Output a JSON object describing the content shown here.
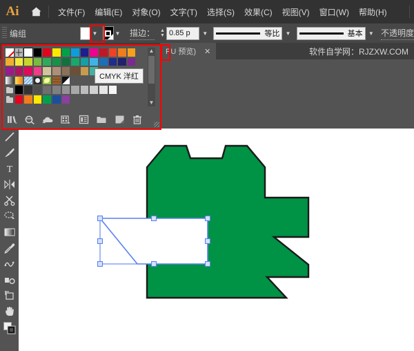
{
  "app": {
    "logo_text": "Ai",
    "home_icon": "home-icon"
  },
  "menubar": {
    "items": [
      {
        "label": "文件(F)",
        "name": "menu-file"
      },
      {
        "label": "编辑(E)",
        "name": "menu-edit"
      },
      {
        "label": "对象(O)",
        "name": "menu-object"
      },
      {
        "label": "文字(T)",
        "name": "menu-type"
      },
      {
        "label": "选择(S)",
        "name": "menu-select"
      },
      {
        "label": "效果(C)",
        "name": "menu-effect"
      },
      {
        "label": "视图(V)",
        "name": "menu-view"
      },
      {
        "label": "窗口(W)",
        "name": "menu-window"
      },
      {
        "label": "帮助(H)",
        "name": "menu-help"
      }
    ]
  },
  "controlbar": {
    "selection_label": "编组",
    "fill_color": "#ffffff",
    "stroke_color": "#000000",
    "stroke_label": "描边：",
    "stroke_weight": "0.85 p",
    "variable_width_profile": "等比",
    "brush_definition": "基本",
    "opacity_label": "不透明度"
  },
  "tabstrip": {
    "document_tab": "PU 预览)",
    "close_label": "✕",
    "watermark": "软件自学网：RJZXW.COM"
  },
  "swatches": {
    "panel_name": "swatches-panel",
    "tooltip": "CMYK 洋红",
    "rows": [
      [
        {
          "type": "none",
          "name": "swatch-none"
        },
        {
          "type": "registration",
          "name": "swatch-registration"
        },
        {
          "type": "white",
          "name": "swatch-white"
        },
        {
          "type": "solid",
          "color": "#000000",
          "name": "swatch-black"
        },
        {
          "type": "solid",
          "color": "#e3051c",
          "name": "swatch-red"
        },
        {
          "type": "solid",
          "color": "#ffe800",
          "name": "swatch-yellow"
        },
        {
          "type": "solid",
          "color": "#00a14b",
          "name": "swatch-green"
        },
        {
          "type": "solid",
          "color": "#0d9ddb",
          "name": "swatch-cyan"
        },
        {
          "type": "solid",
          "color": "#1b1f8f",
          "name": "swatch-blue"
        },
        {
          "type": "solid",
          "color": "#ec038f",
          "name": "swatch-magenta"
        },
        {
          "type": "solid",
          "color": "#c01728",
          "name": "swatch-dark-red"
        },
        {
          "type": "solid",
          "color": "#ef4123",
          "name": "swatch-red-orange"
        },
        {
          "type": "solid",
          "color": "#f07d1c",
          "name": "swatch-orange"
        },
        {
          "type": "solid",
          "color": "#f6a11d",
          "name": "swatch-amber"
        }
      ],
      [
        {
          "type": "solid",
          "color": "#f2ae30",
          "name": "swatch-gold"
        },
        {
          "type": "solid",
          "color": "#f2ea3a",
          "name": "swatch-light-yellow"
        },
        {
          "type": "solid",
          "color": "#c8d62c",
          "name": "swatch-lime-yellow"
        },
        {
          "type": "solid",
          "color": "#76bb42",
          "name": "swatch-light-green"
        },
        {
          "type": "solid",
          "color": "#2eab5a",
          "name": "swatch-medium-green"
        },
        {
          "type": "solid",
          "color": "#189049",
          "name": "swatch-forest-green"
        },
        {
          "type": "solid",
          "color": "#11713f",
          "name": "swatch-dark-green"
        },
        {
          "type": "solid",
          "color": "#18a86b",
          "name": "swatch-emerald"
        },
        {
          "type": "solid",
          "color": "#13a0a6",
          "name": "swatch-teal"
        },
        {
          "type": "solid",
          "color": "#3fb3e8",
          "name": "swatch-sky-blue"
        },
        {
          "type": "solid",
          "color": "#1a6fb8",
          "name": "swatch-steel-blue"
        },
        {
          "type": "solid",
          "color": "#1d2e8c",
          "name": "swatch-navy"
        },
        {
          "type": "solid",
          "color": "#21216b",
          "name": "swatch-dark-navy"
        },
        {
          "type": "solid",
          "color": "#7b2a8e",
          "name": "swatch-purple"
        }
      ],
      [
        {
          "type": "solid",
          "color": "#9c1a8c",
          "name": "swatch-violet"
        },
        {
          "type": "solid",
          "color": "#b01262",
          "name": "swatch-fuchsia"
        },
        {
          "type": "solid",
          "color": "#e3075c",
          "name": "swatch-crimson"
        },
        {
          "type": "solid",
          "color": "#ef3e87",
          "name": "swatch-pink"
        },
        {
          "type": "solid",
          "color": "#cfc49a",
          "name": "swatch-beige"
        },
        {
          "type": "solid",
          "color": "#ad8f76",
          "name": "swatch-tan"
        },
        {
          "type": "solid",
          "color": "#8b7257",
          "name": "swatch-taupe"
        },
        {
          "type": "solid",
          "color": "#6d4f33",
          "name": "swatch-brown"
        },
        {
          "type": "solid",
          "color": "#c89a4e",
          "name": "swatch-sand"
        },
        {
          "type": "solid",
          "color": "#3fb3a0",
          "name": "swatch-aqua"
        },
        {
          "type": "empty",
          "name": "swatch-empty"
        },
        {
          "type": "empty",
          "name": "swatch-empty"
        },
        {
          "type": "empty",
          "name": "swatch-empty"
        },
        {
          "type": "empty",
          "name": "swatch-empty"
        }
      ],
      [
        {
          "type": "grad-bw",
          "name": "swatch-gradient-white-black"
        },
        {
          "type": "grad-ylo",
          "name": "swatch-gradient-yellow-orange"
        },
        {
          "type": "grad-blue",
          "name": "swatch-pattern-blue-check"
        },
        {
          "type": "pat-dot",
          "name": "swatch-pattern-dot"
        },
        {
          "type": "pat-leaf",
          "name": "swatch-pattern-leaf"
        },
        {
          "type": "pat-brick",
          "name": "swatch-pattern-brick"
        },
        {
          "type": "half",
          "name": "swatch-pattern-diagonal"
        },
        {
          "type": "empty",
          "name": "swatch-empty"
        },
        {
          "type": "empty",
          "name": "swatch-empty"
        },
        {
          "type": "empty",
          "name": "swatch-empty"
        },
        {
          "type": "empty",
          "name": "swatch-empty"
        },
        {
          "type": "empty",
          "name": "swatch-empty"
        },
        {
          "type": "empty",
          "name": "swatch-empty"
        },
        {
          "type": "empty",
          "name": "swatch-empty"
        }
      ],
      [
        {
          "type": "folder",
          "name": "swatch-group-grayscale"
        },
        {
          "type": "solid",
          "color": "#000000",
          "name": "swatch-gray-0"
        },
        {
          "type": "solid",
          "color": "#333333",
          "name": "swatch-gray-10"
        },
        {
          "type": "solid",
          "color": "#4f4f4f",
          "name": "swatch-gray-20"
        },
        {
          "type": "solid",
          "color": "#6e6e6e",
          "name": "swatch-gray-30"
        },
        {
          "type": "solid",
          "color": "#808080",
          "name": "swatch-gray-40"
        },
        {
          "type": "solid",
          "color": "#949494",
          "name": "swatch-gray-50"
        },
        {
          "type": "solid",
          "color": "#a8a8a8",
          "name": "swatch-gray-60"
        },
        {
          "type": "solid",
          "color": "#bdbdbd",
          "name": "swatch-gray-70"
        },
        {
          "type": "solid",
          "color": "#d2d2d2",
          "name": "swatch-gray-80"
        },
        {
          "type": "solid",
          "color": "#e6e6e6",
          "name": "swatch-gray-90"
        },
        {
          "type": "solid",
          "color": "#f5f5f5",
          "name": "swatch-gray-95"
        },
        {
          "type": "empty",
          "name": "swatch-empty"
        },
        {
          "type": "empty",
          "name": "swatch-empty"
        }
      ],
      [
        {
          "type": "folder",
          "name": "swatch-group-brights"
        },
        {
          "type": "solid",
          "color": "#e3051c",
          "name": "swatch-bright-red"
        },
        {
          "type": "solid",
          "color": "#f07d1c",
          "name": "swatch-bright-orange"
        },
        {
          "type": "solid",
          "color": "#ffe800",
          "name": "swatch-bright-yellow"
        },
        {
          "type": "solid",
          "color": "#00a14b",
          "name": "swatch-bright-green"
        },
        {
          "type": "solid",
          "color": "#1a4fa0",
          "name": "swatch-bright-blue"
        },
        {
          "type": "solid",
          "color": "#8b3f9e",
          "name": "swatch-bright-purple"
        },
        {
          "type": "empty",
          "name": "swatch-empty"
        },
        {
          "type": "empty",
          "name": "swatch-empty"
        },
        {
          "type": "empty",
          "name": "swatch-empty"
        },
        {
          "type": "empty",
          "name": "swatch-empty"
        },
        {
          "type": "empty",
          "name": "swatch-empty"
        },
        {
          "type": "empty",
          "name": "swatch-empty"
        },
        {
          "type": "empty",
          "name": "swatch-empty"
        }
      ]
    ],
    "footer_icons": [
      {
        "name": "swatch-libraries-icon"
      },
      {
        "name": "show-swatch-kinds-icon"
      },
      {
        "name": "color-themes-cloud-icon"
      },
      {
        "name": "color-group-icon"
      },
      {
        "name": "swatch-options-icon"
      },
      {
        "name": "new-color-group-icon"
      },
      {
        "name": "new-swatch-icon"
      },
      {
        "name": "delete-swatch-icon"
      }
    ]
  },
  "toolbar": {
    "tools": [
      {
        "name": "line-segment-tool"
      },
      {
        "name": "paintbrush-tool"
      },
      {
        "name": "type-tool"
      },
      {
        "name": "reflect-tool"
      },
      {
        "name": "scissors-tool"
      },
      {
        "name": "lasso-tool"
      },
      {
        "name": "gradient-tool"
      },
      {
        "name": "eyedropper-tool"
      },
      {
        "name": "blend-tool"
      },
      {
        "name": "symbol-sprayer-tool"
      },
      {
        "name": "artboard-tool"
      },
      {
        "name": "hand-tool"
      },
      {
        "name": "fill-stroke-indicator"
      }
    ]
  },
  "canvas": {
    "artwork_fill": "#009245",
    "artwork_stroke": "#1a1a1a",
    "inner_fill": "#ffffff",
    "selection_color": "#5b83f0",
    "handle_fill": "#d7e2fb"
  },
  "highlights": {
    "accent": "#ff0000"
  }
}
